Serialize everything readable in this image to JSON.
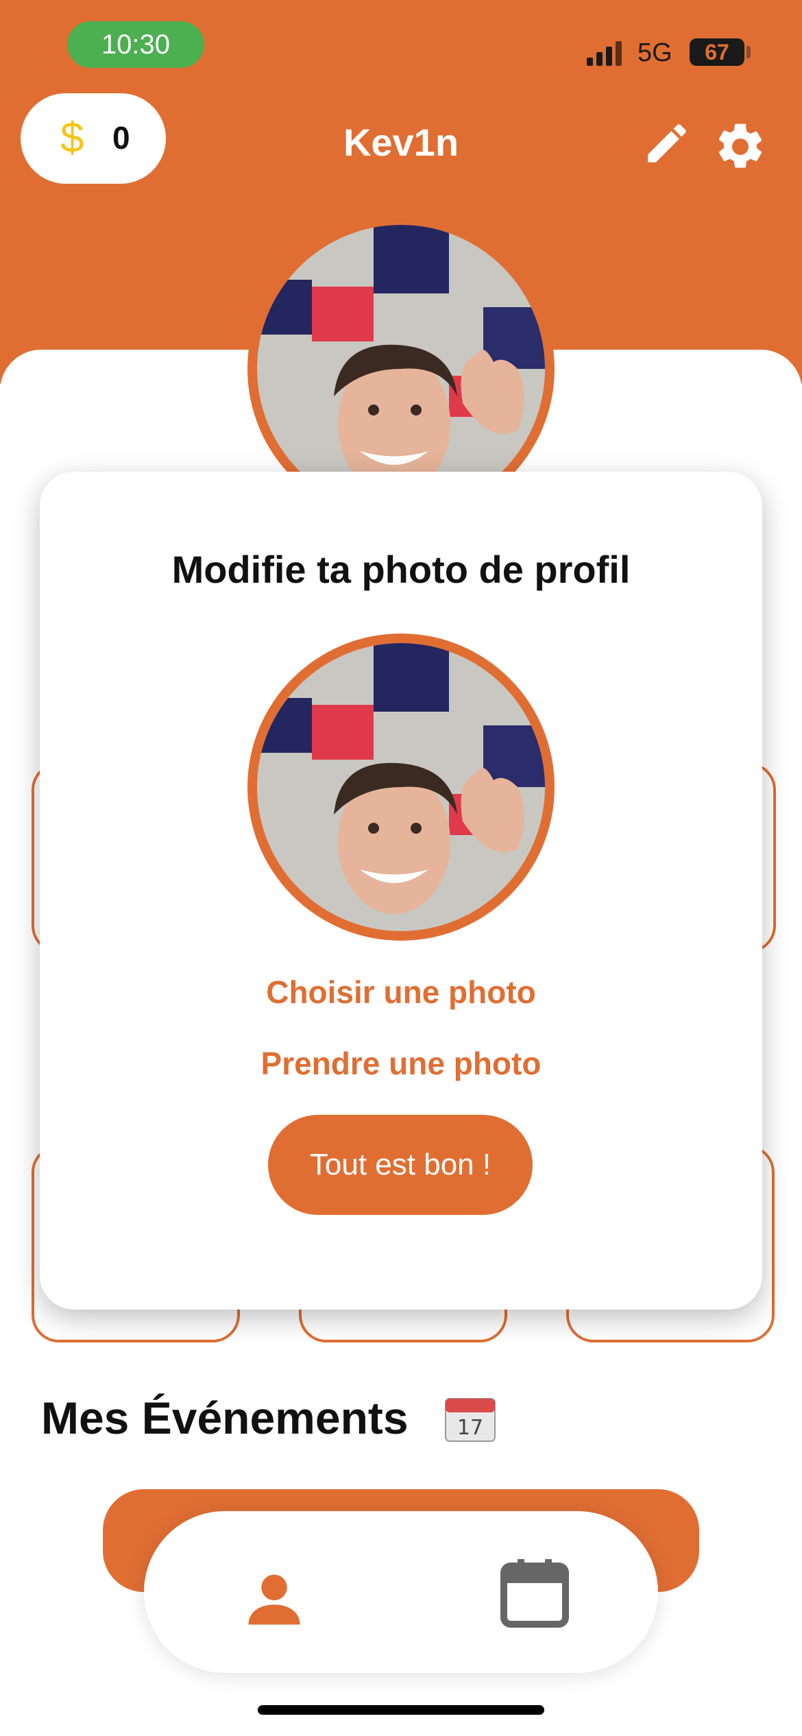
{
  "status_bar": {
    "time": "10:30",
    "network": "5G",
    "battery": "67"
  },
  "header": {
    "coins_icon": "$",
    "coins": "0",
    "username": "Kev1n",
    "edit_icon": "pencil-icon",
    "settings_icon": "gear-icon"
  },
  "modal": {
    "title": "Modifie ta photo de profil",
    "choose_photo": "Choisir une photo",
    "take_photo": "Prendre une photo",
    "confirm": "Tout est bon !"
  },
  "events": {
    "title": "Mes Événements"
  },
  "tabbar": {
    "items": [
      "profile-icon",
      "calendar-icon"
    ]
  },
  "colors": {
    "accent": "#E06E33",
    "status_green": "#4CAF50",
    "coin": "#F5C518"
  }
}
